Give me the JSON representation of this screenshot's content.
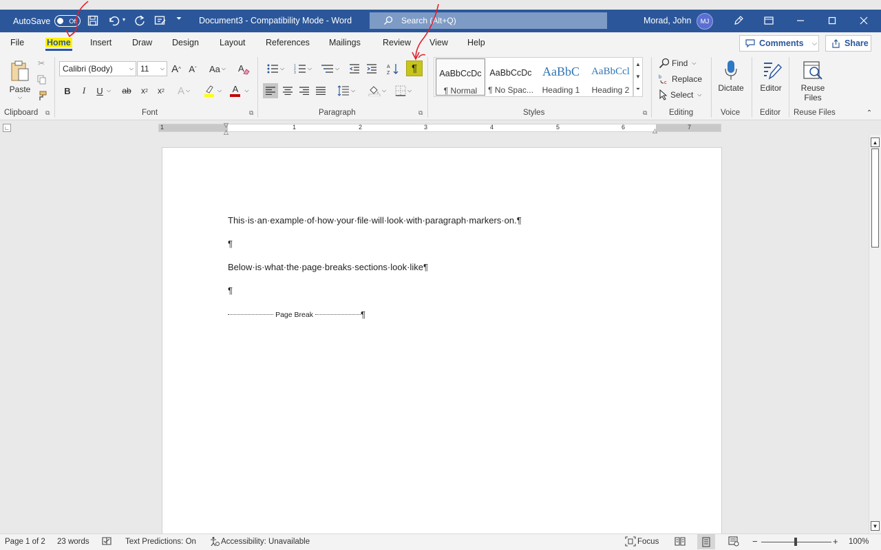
{
  "titlebar": {
    "autosave_label": "AutoSave",
    "autosave_state": "Off",
    "doc_title": "Document3  -  Compatibility Mode  -  Word",
    "search_placeholder": "Search (Alt+Q)",
    "user_name": "Morad, John",
    "user_initials": "MJ",
    "icons": [
      "save-icon",
      "undo-icon",
      "redo-icon",
      "touch-mode-icon",
      "customize-qat-icon",
      "pen-icon",
      "ribbon-display-icon",
      "minimize-icon",
      "maximize-icon",
      "close-icon"
    ]
  },
  "tabs": [
    "File",
    "Home",
    "Insert",
    "Draw",
    "Design",
    "Layout",
    "References",
    "Mailings",
    "Review",
    "View",
    "Help"
  ],
  "active_tab": "Home",
  "comments_label": "Comments",
  "share_label": "Share",
  "ribbon": {
    "clipboard": {
      "paste_label": "Paste",
      "group_label": "Clipboard"
    },
    "font": {
      "font_name": "Calibri (Body)",
      "font_size": "11",
      "group_label": "Font",
      "case_label": "Aa",
      "bold": "B",
      "italic": "I",
      "underline": "U",
      "strike": "ab",
      "subscript": "x",
      "superscript": "x",
      "effects_label": "A",
      "font_color_label": "A",
      "grow_label": "A",
      "shrink_label": "A",
      "font_color": "#c00000",
      "highlight_color": "#ffff00"
    },
    "paragraph": {
      "group_label": "Paragraph",
      "show_marks_symbol": "¶",
      "show_marks_active": true,
      "align_left_active": true
    },
    "styles": {
      "group_label": "Styles",
      "items": [
        {
          "preview": "AaBbCcDc",
          "name": "¶ Normal"
        },
        {
          "preview": "AaBbCcDc",
          "name": "¶ No Spac..."
        },
        {
          "preview": "AaBbC",
          "name": "Heading 1"
        },
        {
          "preview": "AaBbCcl",
          "name": "Heading 2"
        }
      ]
    },
    "editing": {
      "find_label": "Find",
      "replace_label": "Replace",
      "select_label": "Select",
      "group_label": "Editing"
    },
    "voice": {
      "dictate_label": "Dictate",
      "group_label": "Voice"
    },
    "editor": {
      "editor_label": "Editor",
      "group_label": "Editor"
    },
    "reuse": {
      "reuse_label_line1": "Reuse",
      "reuse_label_line2": "Files",
      "group_label": "Reuse Files"
    }
  },
  "ruler_numbers": [
    "1",
    "1",
    "2",
    "3",
    "4",
    "5",
    "6",
    "7"
  ],
  "document": {
    "paragraphs": [
      "This·is·an·example·of·how·your·file·will·look·with·paragraph·markers·on.¶",
      "¶",
      "Below·is·what·the·page·breaks·sections·look·like¶",
      "¶"
    ],
    "page_break_label": "Page Break",
    "page_break_mark": "¶"
  },
  "statusbar": {
    "page": "Page 1 of 2",
    "words": "23 words",
    "text_predictions": "Text Predictions: On",
    "accessibility": "Accessibility: Unavailable",
    "focus": "Focus",
    "zoom": "100%",
    "zoom_minus": "−",
    "zoom_plus": "+"
  }
}
